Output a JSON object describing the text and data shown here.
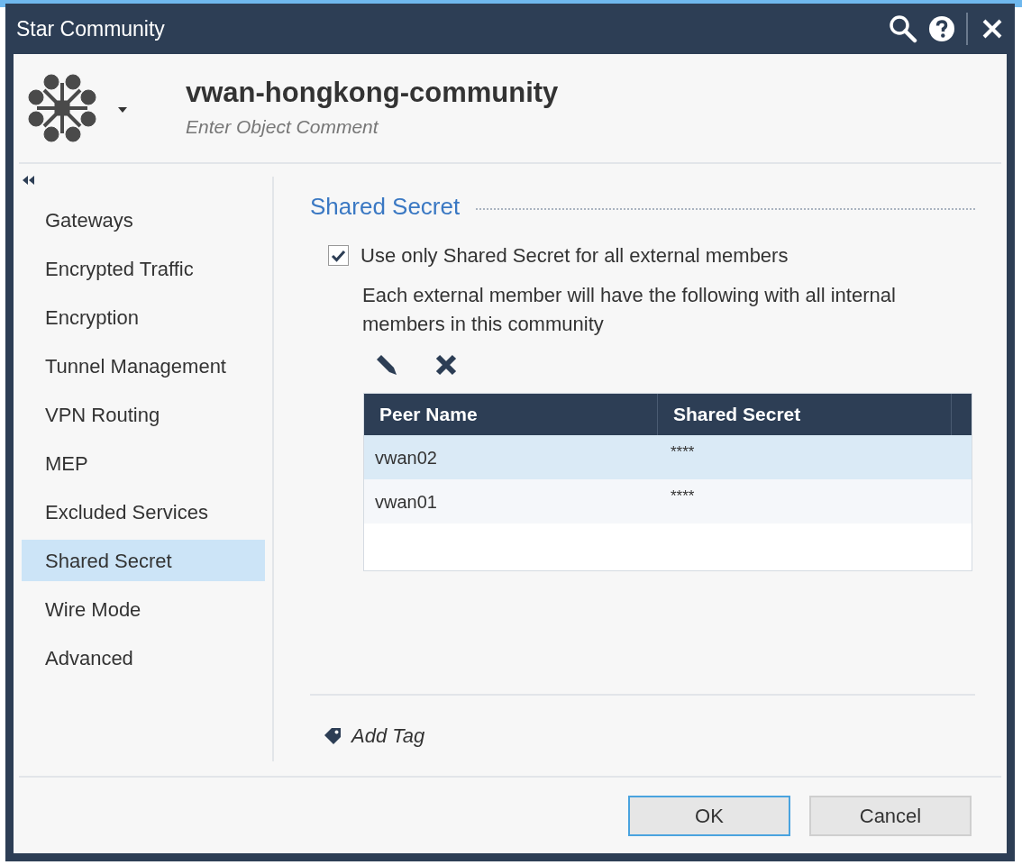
{
  "window": {
    "title": "Star Community"
  },
  "header": {
    "name": "vwan-hongkong-community",
    "comment_placeholder": "Enter Object Comment"
  },
  "sidebar": {
    "items": [
      {
        "label": "Gateways",
        "selected": false
      },
      {
        "label": "Encrypted Traffic",
        "selected": false
      },
      {
        "label": "Encryption",
        "selected": false
      },
      {
        "label": "Tunnel Management",
        "selected": false
      },
      {
        "label": "VPN Routing",
        "selected": false
      },
      {
        "label": "MEP",
        "selected": false
      },
      {
        "label": "Excluded Services",
        "selected": false
      },
      {
        "label": "Shared Secret",
        "selected": true
      },
      {
        "label": "Wire Mode",
        "selected": false
      },
      {
        "label": "Advanced",
        "selected": false
      }
    ]
  },
  "section": {
    "title": "Shared Secret",
    "checkbox": {
      "label": "Use only Shared Secret for all external members",
      "checked": true
    },
    "description": "Each external member will have the following with all internal members in this community",
    "table": {
      "columns": [
        "Peer Name",
        "Shared Secret"
      ],
      "rows": [
        {
          "cells": [
            "vwan02",
            "****"
          ],
          "selected": true
        },
        {
          "cells": [
            "vwan01",
            "****"
          ],
          "selected": false
        }
      ]
    }
  },
  "add_tag": "Add Tag",
  "buttons": [
    {
      "label": "OK",
      "default": true
    },
    {
      "label": "Cancel",
      "default": false
    }
  ]
}
